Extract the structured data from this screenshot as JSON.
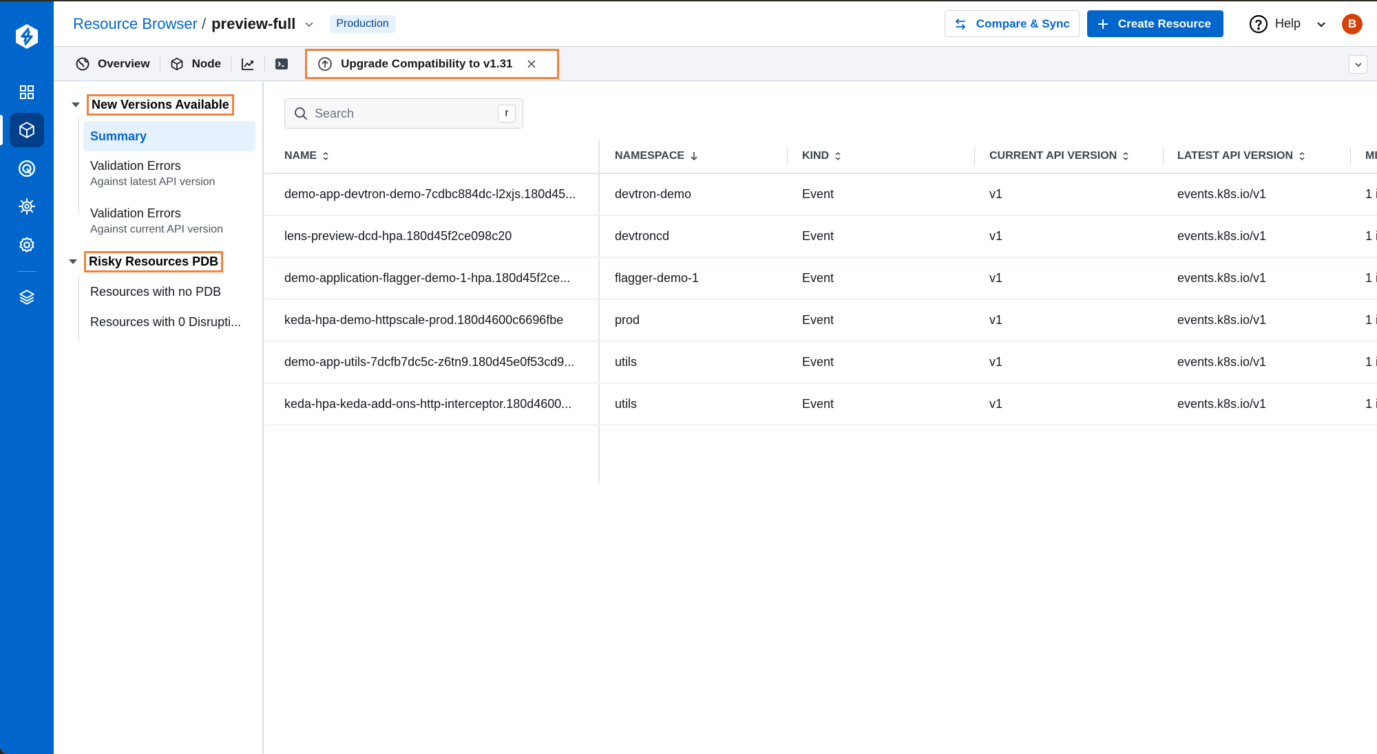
{
  "header": {
    "breadcrumb_root": "Resource Browser",
    "breadcrumb_sep": "/",
    "cluster_name": "preview-full",
    "env_badge": "Production",
    "compare_sync_label": "Compare & Sync",
    "create_resource_label": "Create Resource",
    "help_label": "Help",
    "avatar_initial": "B"
  },
  "nav": {
    "items": [
      {
        "icon": "grid-icon",
        "label": "Applications"
      },
      {
        "icon": "cube-icon",
        "label": "Resource Browser",
        "active": true
      },
      {
        "icon": "radar-icon",
        "label": "Security"
      },
      {
        "icon": "helm-wheel-icon",
        "label": "Chart Store"
      },
      {
        "icon": "gear-icon",
        "label": "Global Configurations"
      },
      {
        "icon": "layers-icon",
        "label": "Stack Manager"
      }
    ]
  },
  "tabs": {
    "overview": "Overview",
    "node": "Node",
    "monitoring_icon": "chart-line-icon",
    "terminal_icon": "terminal-icon",
    "active": "Upgrade Compatibility to v1.31"
  },
  "sidebar": {
    "groups": [
      {
        "label": "New Versions Available",
        "items": [
          {
            "title": "Summary",
            "active": true
          },
          {
            "title": "Validation Errors",
            "sub": "Against latest API version"
          },
          {
            "title": "Validation Errors",
            "sub": "Against current API version"
          }
        ]
      },
      {
        "label": "Risky Resources PDB",
        "items": [
          {
            "title": "Resources with no PDB"
          },
          {
            "title": "Resources with 0 Disrupti..."
          }
        ]
      }
    ]
  },
  "search": {
    "placeholder": "Search",
    "value": "",
    "shortcut": "r"
  },
  "table": {
    "columns": [
      {
        "label": "NAME",
        "sort": "both"
      },
      {
        "label": "NAMESPACE",
        "sort": "desc"
      },
      {
        "label": "KIND",
        "sort": "both"
      },
      {
        "label": "CURRENT API VERSION",
        "sort": "both"
      },
      {
        "label": "LATEST API VERSION",
        "sort": "both"
      },
      {
        "label": "MI",
        "sort": "none"
      }
    ],
    "rows": [
      {
        "name": "demo-app-devtron-demo-7cdbc884dc-l2xjs.180d45...",
        "namespace": "devtron-demo",
        "kind": "Event",
        "current": "v1",
        "latest": "events.k8s.io/v1",
        "more": "1 i"
      },
      {
        "name": "lens-preview-dcd-hpa.180d45f2ce098c20",
        "namespace": "devtroncd",
        "kind": "Event",
        "current": "v1",
        "latest": "events.k8s.io/v1",
        "more": "1 i"
      },
      {
        "name": "demo-application-flagger-demo-1-hpa.180d45f2ce...",
        "namespace": "flagger-demo-1",
        "kind": "Event",
        "current": "v1",
        "latest": "events.k8s.io/v1",
        "more": "1 i"
      },
      {
        "name": "keda-hpa-demo-httpscale-prod.180d4600c6696fbe",
        "namespace": "prod",
        "kind": "Event",
        "current": "v1",
        "latest": "events.k8s.io/v1",
        "more": "1 i"
      },
      {
        "name": "demo-app-utils-7dcfb7dc5c-z6tn9.180d45e0f53cd9...",
        "namespace": "utils",
        "kind": "Event",
        "current": "v1",
        "latest": "events.k8s.io/v1",
        "more": "1 i"
      },
      {
        "name": "keda-hpa-keda-add-ons-http-interceptor.180d4600...",
        "namespace": "utils",
        "kind": "Event",
        "current": "v1",
        "latest": "events.k8s.io/v1",
        "more": "1 i"
      }
    ]
  },
  "colors": {
    "brand": "#0066cc",
    "highlight": "#f0823a",
    "avatar": "#d4420b"
  }
}
